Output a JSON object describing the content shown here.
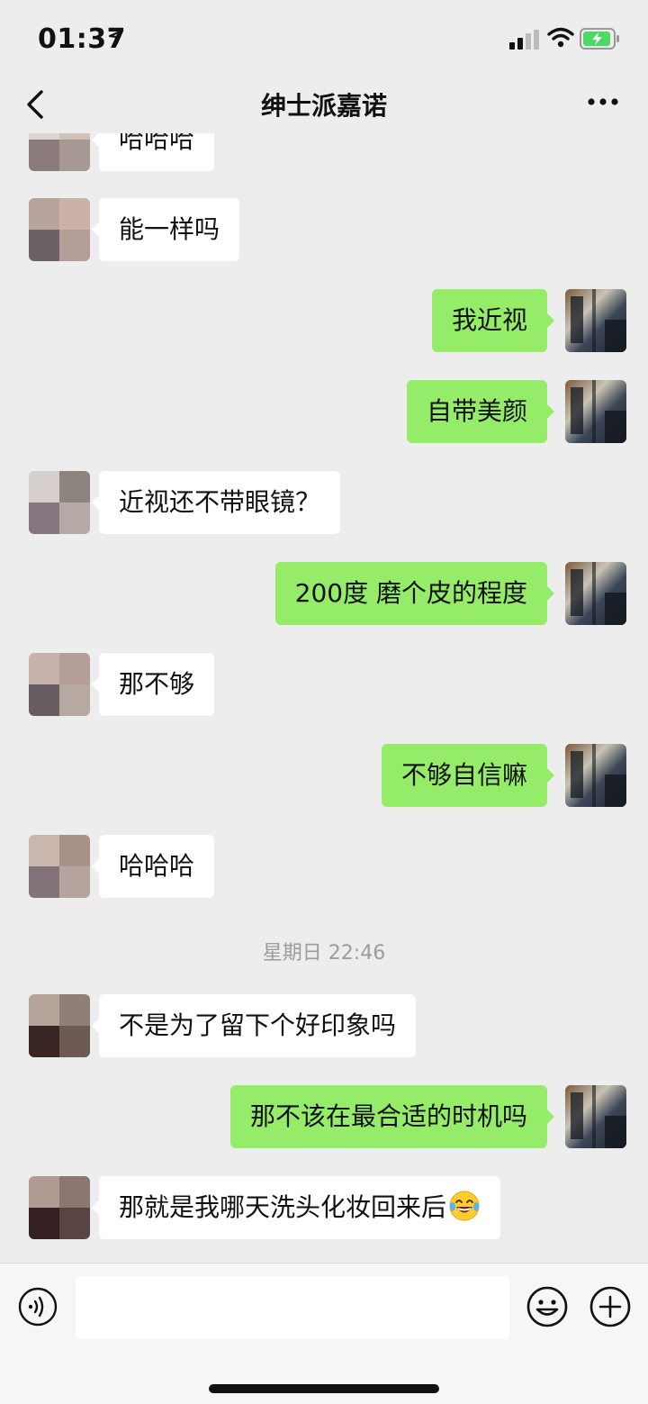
{
  "status_bar": {
    "time": "01:37"
  },
  "header": {
    "title": "绅士派嘉诺"
  },
  "messages": [
    {
      "side": "left",
      "text": "哈哈哈"
    },
    {
      "side": "left",
      "text": "能一样吗"
    },
    {
      "side": "right",
      "text": "我近视"
    },
    {
      "side": "right",
      "text": "自带美颜"
    },
    {
      "side": "left",
      "text": "近视还不带眼镜？"
    },
    {
      "side": "right",
      "text": "200度 磨个皮的程度"
    },
    {
      "side": "left",
      "text": "那不够"
    },
    {
      "side": "right",
      "text": "不够自信嘛"
    },
    {
      "side": "left",
      "text": "哈哈哈"
    },
    {
      "side": "left",
      "text": "不是为了留下个好印象吗"
    },
    {
      "side": "right",
      "text": "那不该在最合适的时机吗"
    },
    {
      "side": "left",
      "text": "那就是我哪天洗头化妆回来后",
      "emoji": "laughing-tears-emoji"
    }
  ],
  "timestamp": "星期日 22:46",
  "colors": {
    "sent_bubble": "#95ec69",
    "received_bubble": "#ffffff",
    "background": "#ededed"
  },
  "icons": [
    "location-arrow-icon",
    "signal-icon",
    "wifi-icon",
    "battery-charging-icon",
    "back-chevron-icon",
    "more-icon",
    "voice-icon",
    "emoji-icon",
    "plus-icon"
  ]
}
